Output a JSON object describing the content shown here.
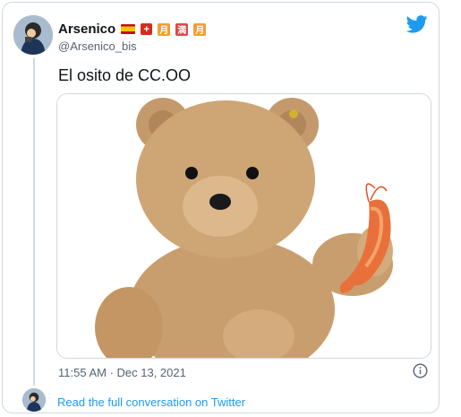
{
  "tweet": {
    "display_name": "Arsenico",
    "badges": [
      "flag-spain",
      "swiss-cross",
      "月",
      "満",
      "月"
    ],
    "handle": "@Arsenico_bis",
    "text": "El osito de CC.OO",
    "timestamp": "11:55 AM · Dec 13, 2021"
  },
  "footer": {
    "read_link": "Read the full conversation on Twitter"
  },
  "colors": {
    "link": "#1d9bf0",
    "muted": "#536471",
    "border": "#cfd9de"
  }
}
